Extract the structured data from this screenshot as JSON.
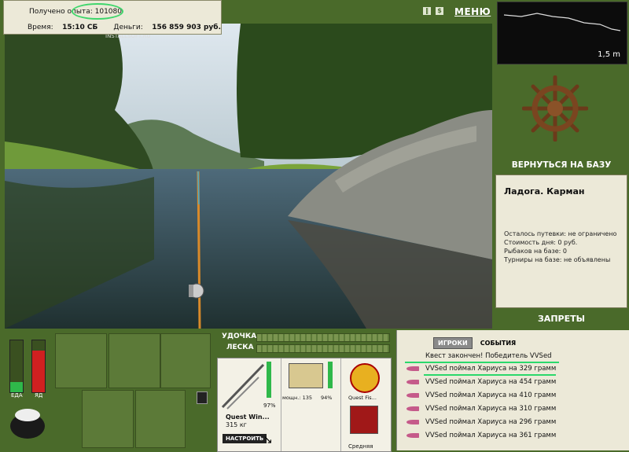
{
  "stats": {
    "xp_label": "Получено опыта:",
    "xp_value": "101080",
    "time_label": "Время:",
    "time_value": "15:10 СБ",
    "money_label": "Деньги:",
    "money_value": "156 859 903 руб."
  },
  "topbar": {
    "pause_icon": "pause-icon",
    "sound_icon": "dollar-icon",
    "menu_label": "МЕНЮ"
  },
  "right": {
    "depth_value": "1,5 m",
    "return_label": "ВЕРНУТЬСЯ НА БАЗУ",
    "location": "Ладога. Карман",
    "info_lines": [
      "Осталось путевки: не ограничено",
      "Стоимость дня: 0 руб.",
      "Рыбаков на базе: 0",
      "Турниры на базе: не объявлены"
    ],
    "bans_label": "ЗАПРЕТЫ"
  },
  "bottom": {
    "food_label": "ЕДА",
    "poison_label": "ЯД",
    "rod_label": "УДОЧКА",
    "line_label": "ЛЕСКА",
    "rod_name": "Quest Win...",
    "rod_weight": "315 кг",
    "rod_pct": "97%",
    "reel_power": "мощн.: 135",
    "reel_pct": "94%",
    "line_name": "Quest Fis...",
    "lure_level": "Средняя",
    "setup_label": "НАСТРОИТЬ",
    "food_level": 0.2,
    "poison_level": 0.8
  },
  "chat": {
    "tab_players": "ИГРОКИ",
    "tab_events": "СОБЫТИЯ",
    "quest_msg": "Квест закончен! Победитель VVSed",
    "lines": [
      "VVSed поймал Хариуса на 329 грамм",
      "VVSed поймал Хариуса на 454 грамм",
      "VVSed поймал Хариуса на 410 грамм",
      "VVSed поймал Хариуса на 310 грамм",
      "VVSed поймал Хариуса на 296 грамм",
      "VVSed поймал Хариуса на 361 грамм"
    ]
  },
  "watermark": "INSTALLSOFT.RU"
}
